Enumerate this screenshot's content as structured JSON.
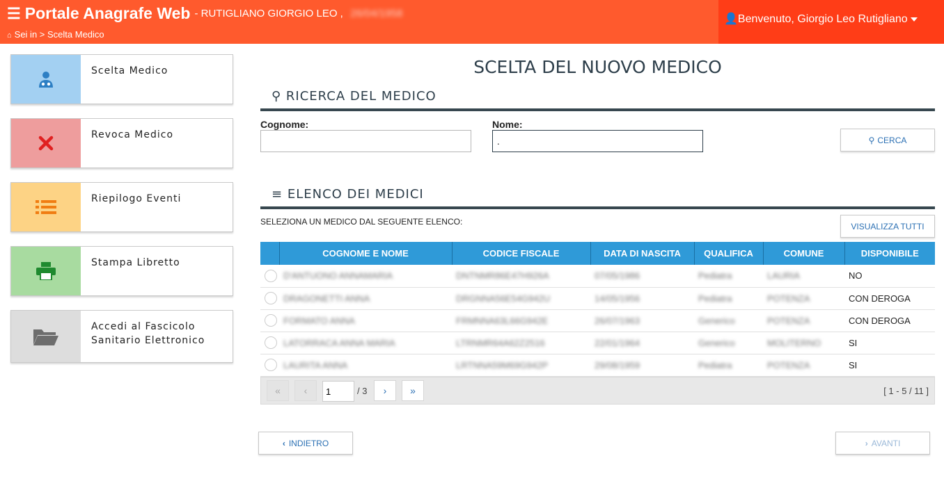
{
  "header": {
    "menu_icon": "hamburger-icon",
    "app_title": "Portale Anagrafe Web",
    "user_line": "- RUTIGLIANO GIORGIO LEO ,",
    "user_birthdate_redacted": "26/04/1958",
    "breadcrumb": "Sei in > Scelta Medico",
    "welcome": "Benvenuto, Giorgio Leo Rutigliano",
    "colors": {
      "bar": "#ff5a2d",
      "user_box": "#ff3d17"
    }
  },
  "sidebar": {
    "items": [
      {
        "label": "Scelta Medico",
        "icon": "doctor-icon",
        "color": "#a3d0f2"
      },
      {
        "label": "Revoca Medico",
        "icon": "close-icon",
        "color": "#ee9d9d"
      },
      {
        "label": "Riepilogo Eventi",
        "icon": "list-icon",
        "color": "#fdd385"
      },
      {
        "label": "Stampa Libretto",
        "icon": "printer-icon",
        "color": "#a8dba0"
      },
      {
        "label": "Accedi al Fascicolo\nSanitario Elettronico",
        "icon": "folder-open-icon",
        "color": "#dddddd"
      }
    ]
  },
  "main": {
    "title": "SCELTA DEL NUOVO MEDICO",
    "search_section": {
      "title": "RICERCA DEL MEDICO",
      "icon": "search-icon",
      "surname_label": "Cognome:",
      "surname_value": "",
      "name_label": "Nome:",
      "name_value": ".",
      "search_button": "CERCA"
    },
    "list_section": {
      "title": "ELENCO DEI MEDICI",
      "icon": "list-icon",
      "instruction": "SELEZIONA UN MEDICO DAL SEGUENTE ELENCO:",
      "show_all_button": "VISUALIZZA TUTTI",
      "columns": [
        "",
        "COGNOME E NOME",
        "CODICE FISCALE",
        "DATA DI NASCITA",
        "QUALIFICA",
        "COMUNE",
        "DISPONIBILE"
      ],
      "rows": [
        {
          "name": "D'ANTUONO ANNAMARIA",
          "cf": "DNTNMR86E47H926A",
          "birth": "07/05/1986",
          "qual": "Pediatra",
          "town": "LAURIA",
          "avail": "NO"
        },
        {
          "name": "DRAGONETTI ANNA",
          "cf": "DRGNNA56E54G942U",
          "birth": "14/05/1956",
          "qual": "Pediatra",
          "town": "POTENZA",
          "avail": "CON DEROGA"
        },
        {
          "name": "FORMATO ANNA",
          "cf": "FRMNNA63L66G942E",
          "birth": "26/07/1963",
          "qual": "Generico",
          "town": "POTENZA",
          "avail": "CON DEROGA"
        },
        {
          "name": "LATORRACA ANNA MARIA",
          "cf": "LTRNMR64A62Z2516",
          "birth": "22/01/1964",
          "qual": "Generico",
          "town": "MOLITERNO",
          "avail": "SI"
        },
        {
          "name": "LAURITA ANNA",
          "cf": "LRTNNA59M69G942P",
          "birth": "29/08/1959",
          "qual": "Pediatra",
          "town": "POTENZA",
          "avail": "SI"
        }
      ],
      "header_color": "#2f9ad8"
    },
    "pager": {
      "first": "«",
      "prev": "‹",
      "page": "1",
      "total": "/ 3",
      "next": "›",
      "last": "»",
      "range": "[ 1 - 5 / 11 ]"
    },
    "back_button": "INDIETRO",
    "next_button": "AVANTI"
  }
}
